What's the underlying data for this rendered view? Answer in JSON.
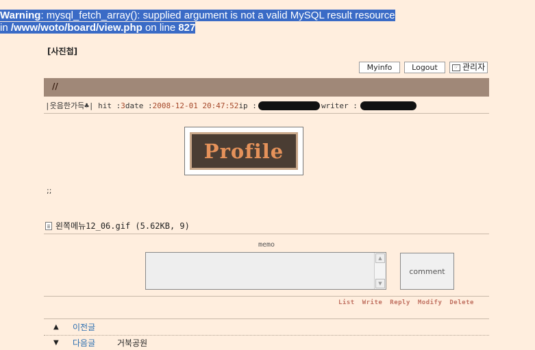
{
  "warning": {
    "label": "Warning",
    "message": ": mysql_fetch_array(): supplied argument is not a valid MySQL result resource",
    "in_prefix": "in ",
    "path": "/www/woto/board/view.php",
    "on_line": " on line ",
    "line": "827"
  },
  "board_title": "[사진첩]",
  "top_buttons": {
    "myinfo": "Myinfo",
    "logout": "Logout",
    "admin": "관리자"
  },
  "post": {
    "subject": "//",
    "author_prefix": "| ",
    "author": "웃음한가득",
    "author_suffix": "♣",
    "hit_label": " | hit :",
    "hit": "3",
    "date_label": " date :",
    "date": "2008-12-01 20:47:52",
    "ip_label": " ip :",
    "writer_label": "writer :",
    "image_text": "Profile",
    "body": ";;",
    "attachment": "왼쪽메뉴12_06.gif (5.62KB, 9)"
  },
  "comment": {
    "memo_label": "memo",
    "button": "comment"
  },
  "actions": [
    "List",
    "Write",
    "Reply",
    "Modify",
    "Delete"
  ],
  "nav": {
    "prev": {
      "arrow": "▲",
      "label": "이전글",
      "title": ""
    },
    "next": {
      "arrow": "▼",
      "label": "다음글",
      "title": "거북공원"
    }
  }
}
